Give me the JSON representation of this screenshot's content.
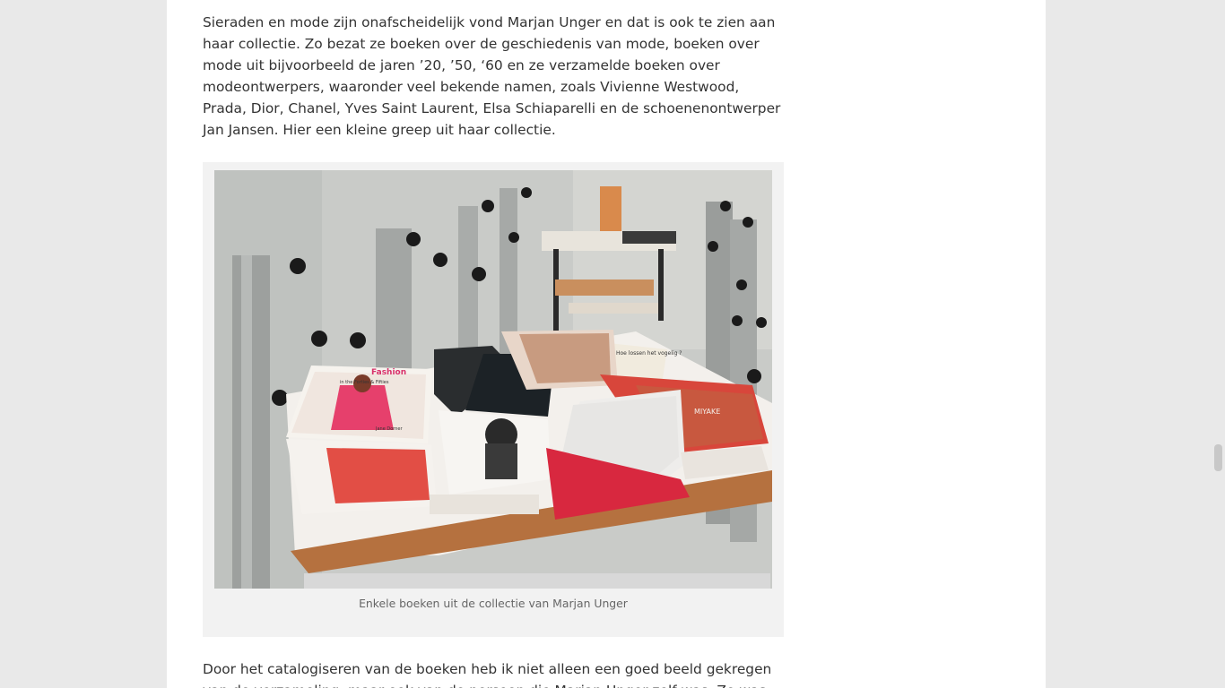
{
  "article": {
    "intro_paragraph": "Sieraden en mode zijn onafscheidelijk vond Marjan Unger en dat is ook te zien aan haar collectie. Zo bezat ze boeken over de geschiedenis van mode, boeken over mode uit bijvoorbeeld de jaren ’20, ’50, ‘60 en ze verzamelde boeken over modeontwerpers, waaronder veel bekende namen, zoals Vivienne Westwood, Prada, Dior, Chanel, Yves Saint Laurent, Elsa Schiaparelli en de schoenenontwerper Jan Jansen. Hier een kleine greep uit haar collectie.",
    "figure": {
      "caption": "Enkele boeken uit de collectie van Marjan Unger",
      "book_titles": {
        "pink_book_brand": "Fashion",
        "pink_book_subtitle": "in the Forties & Fifties",
        "pink_book_author": "Jane Dorner",
        "cream_book": "Hoe lossen het vogelig ?",
        "red_book_spine": "MIYAKE"
      }
    },
    "next_paragraph": "Door het catalogiseren van de boeken heb ik niet alleen een goed beeld gekregen van de verzameling, maar ook van de persoon die Marjan Unger zelf was. Ze was"
  },
  "colors": {
    "page_bg": "#ffffff",
    "outer_bg": "#e9e9e9",
    "text": "#333333",
    "caption": "#666666",
    "figure_bg": "#f2f2f2"
  }
}
